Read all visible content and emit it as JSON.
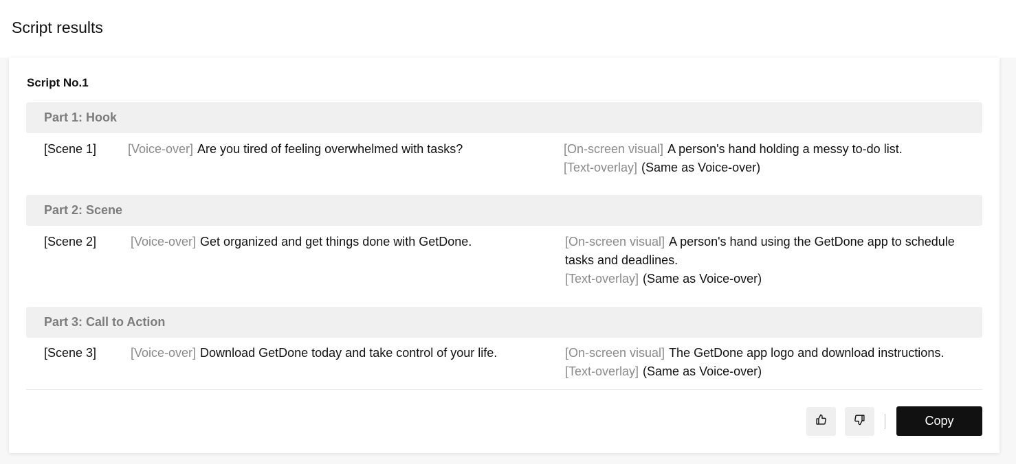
{
  "page": {
    "title": "Script results"
  },
  "script": {
    "title": "Script No.1",
    "tags": {
      "voice_over": "[Voice-over]",
      "on_screen_visual": "[On-screen visual]",
      "text_overlay": "[Text-overlay]"
    },
    "parts": [
      {
        "heading": "Part 1: Hook",
        "scene": "[Scene 1]",
        "voice_over": "Are you tired of feeling overwhelmed with tasks?",
        "on_screen_visual": "A person's hand holding a messy to-do list.",
        "text_overlay": "(Same as Voice-over)"
      },
      {
        "heading": "Part 2: Scene",
        "scene": "[Scene 2]",
        "voice_over": "Get organized and get things done with GetDone.",
        "on_screen_visual": "A person's hand using the GetDone app to schedule tasks and deadlines.",
        "text_overlay": "(Same as Voice-over)"
      },
      {
        "heading": "Part 3: Call to Action",
        "scene": "[Scene 3]",
        "voice_over": "Download GetDone today and take control of your life.",
        "on_screen_visual": "The GetDone app logo and download instructions.",
        "text_overlay": "(Same as Voice-over)"
      }
    ]
  },
  "actions": {
    "like_icon": "thumbs-up-icon",
    "dislike_icon": "thumbs-down-icon",
    "copy_label": "Copy"
  },
  "colors": {
    "accent": "#111111",
    "tag_text": "#8a8a8a",
    "part_header_bg": "#f0f0f0",
    "part_header_text": "#7c7c7c"
  }
}
